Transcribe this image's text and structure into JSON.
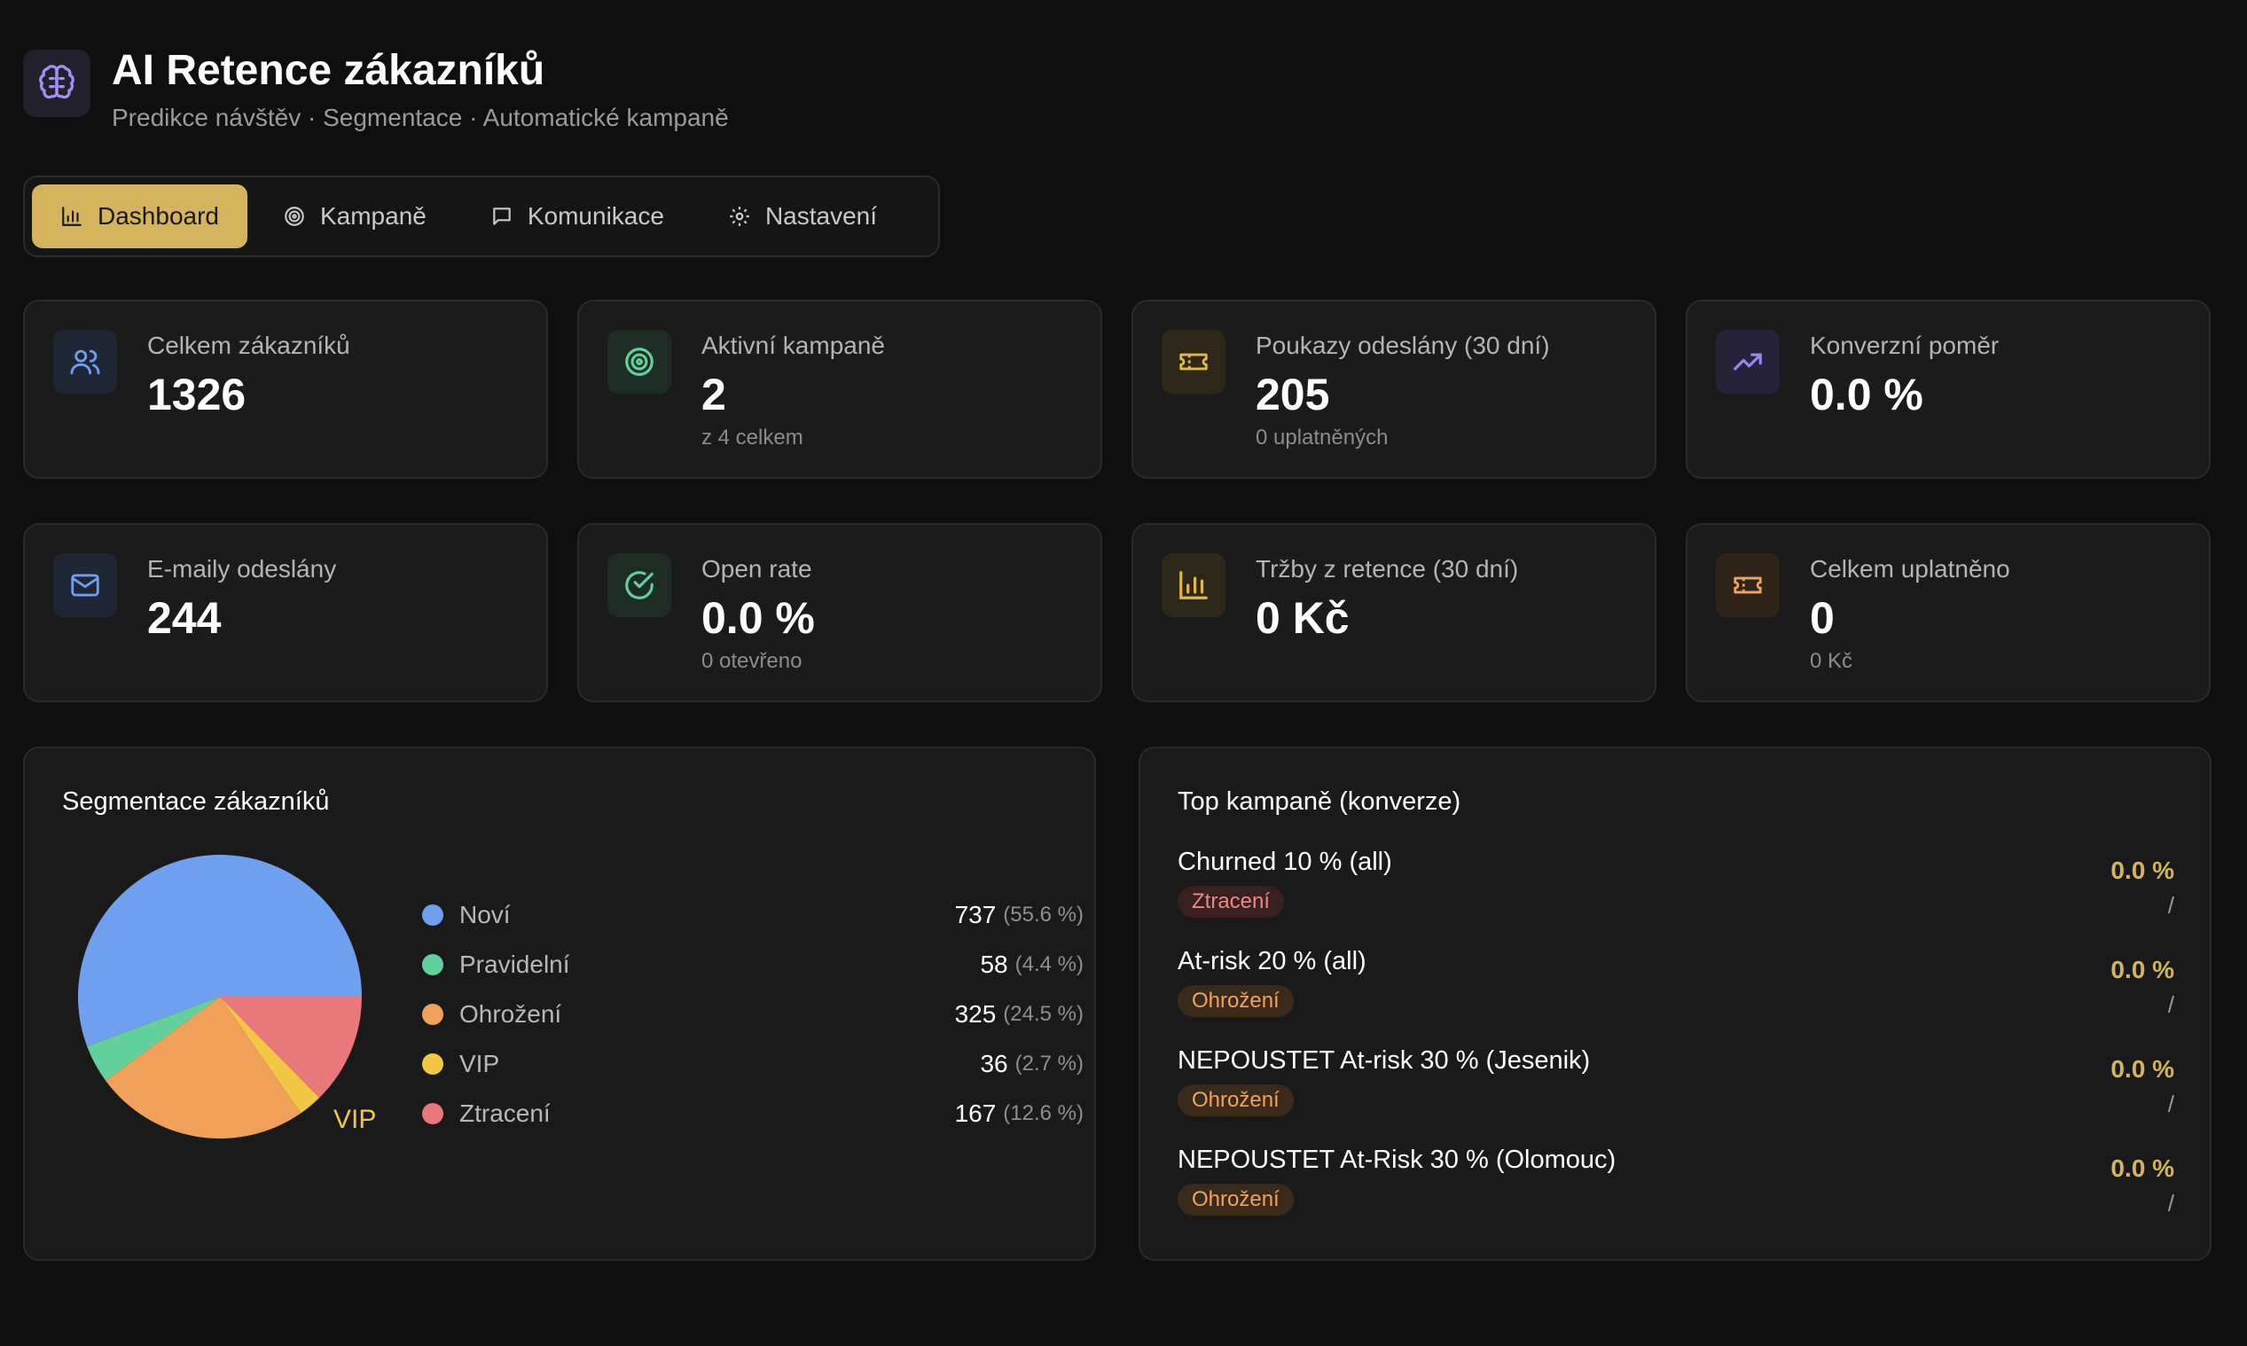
{
  "app": {
    "title": "AI Retence zákazníků",
    "subtitle": "Predikce návštěv · Segmentace · Automatické kampaně"
  },
  "tabs": [
    {
      "label": "Dashboard",
      "icon": "bar-chart-icon",
      "active": true
    },
    {
      "label": "Kampaně",
      "icon": "target-icon",
      "active": false
    },
    {
      "label": "Komunikace",
      "icon": "message-icon",
      "active": false
    },
    {
      "label": "Nastavení",
      "icon": "gear-icon",
      "active": false
    }
  ],
  "stats": [
    {
      "label": "Celkem zákazníků",
      "value": "1326",
      "sub": "",
      "icon": "users-icon",
      "color": "#6fa0f0"
    },
    {
      "label": "Aktivní kampaně",
      "value": "2",
      "sub": "z 4 celkem",
      "icon": "target-icon",
      "color": "#5fd29a"
    },
    {
      "label": "Poukazy odeslány (30 dní)",
      "value": "205",
      "sub": "0 uplatněných",
      "icon": "ticket-icon",
      "color": "#e2b84a"
    },
    {
      "label": "Konverzní poměr",
      "value": "0.0 %",
      "sub": "",
      "icon": "trending-up-icon",
      "color": "#9b86f0"
    },
    {
      "label": "E-maily odeslány",
      "value": "244",
      "sub": "",
      "icon": "mail-icon",
      "color": "#6fa0f0"
    },
    {
      "label": "Open rate",
      "value": "0.0 %",
      "sub": "0 otevřeno",
      "icon": "check-circle-icon",
      "color": "#5fd29a"
    },
    {
      "label": "Tržby z retence (30 dní)",
      "value": "0 Kč",
      "sub": "",
      "icon": "bar-chart-icon",
      "color": "#e2b84a"
    },
    {
      "label": "Celkem uplatněno",
      "value": "0",
      "sub": "0 Kč",
      "icon": "ticket-icon",
      "color": "#f0a35c"
    }
  ],
  "segments": {
    "title": "Segmentace zákazníků",
    "pie_label_vip": "VIP"
  },
  "chart_data": {
    "type": "pie",
    "title": "Segmentace zákazníků",
    "categories": [
      "Noví",
      "Pravidelní",
      "Ohrožení",
      "VIP",
      "Ztracení"
    ],
    "values": [
      737,
      58,
      325,
      36,
      167
    ],
    "percent_labels": [
      "(55.6 %)",
      "(4.4 %)",
      "(24.5 %)",
      "(2.7 %)",
      "(12.6 %)"
    ],
    "colors": [
      "#6fa0f0",
      "#62d19b",
      "#f0a058",
      "#f2c744",
      "#e8787a"
    ]
  },
  "campaigns": {
    "title": "Top kampaně (konverze)",
    "items": [
      {
        "name": "Churned 10 % (all)",
        "badge": "Ztracení",
        "badge_type": "lost",
        "rate": "0.0 %",
        "slash": "/"
      },
      {
        "name": "At-risk 20 % (all)",
        "badge": "Ohrožení",
        "badge_type": "risk",
        "rate": "0.0 %",
        "slash": "/"
      },
      {
        "name": "NEPOUSTET At-risk 30 % (Jesenik)",
        "badge": "Ohrožení",
        "badge_type": "risk",
        "rate": "0.0 %",
        "slash": "/"
      },
      {
        "name": "NEPOUSTET At-Risk 30 % (Olomouc)",
        "badge": "Ohrožení",
        "badge_type": "risk",
        "rate": "0.0 %",
        "slash": "/"
      }
    ]
  }
}
